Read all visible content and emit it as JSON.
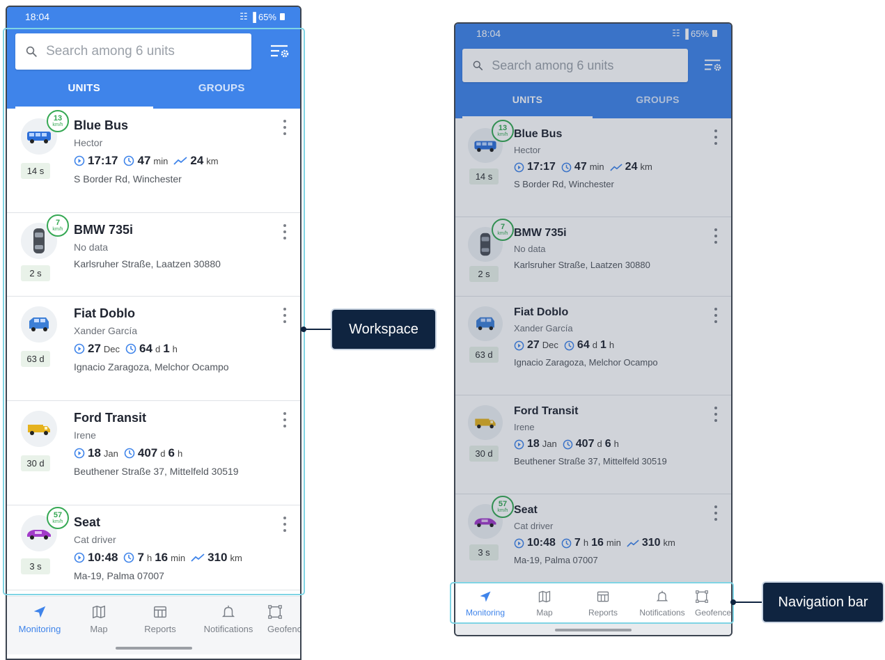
{
  "status_bar": {
    "time": "18:04",
    "battery": "65%"
  },
  "search": {
    "placeholder": "Search among 6 units"
  },
  "tabs": [
    {
      "label": "UNITS",
      "active": true
    },
    {
      "label": "GROUPS",
      "active": false
    }
  ],
  "units": [
    {
      "name": "Blue Bus",
      "driver": "Hector",
      "age": "14 s",
      "speed": "13",
      "speed_unit": "km/h",
      "time": "17:17",
      "duration_a": "47",
      "duration_a_unit": "min",
      "duration_b": "",
      "duration_b_unit": "",
      "mileage": "24",
      "mileage_unit": "km",
      "address": "S Border Rd, Winchester",
      "icon": "blue-bus-icon",
      "color": "#2d6fd8"
    },
    {
      "name": "BMW 735i",
      "driver": "No data",
      "age": "2 s",
      "speed": "7",
      "speed_unit": "km/h",
      "address": "Karlsruher Straße, Laatzen 30880",
      "icon": "black-car-icon",
      "color": "#4a4f57"
    },
    {
      "name": "Fiat Doblo",
      "driver": "Xander García",
      "age": "63 d",
      "date_day": "27",
      "date_month": "Dec",
      "duration_a": "64",
      "duration_a_unit": "d",
      "duration_b": "1",
      "duration_b_unit": "h",
      "address": "Ignacio Zaragoza, Melchor Ocampo",
      "icon": "blue-van-icon",
      "color": "#3d7fd6"
    },
    {
      "name": "Ford Transit",
      "driver": "Irene",
      "age": "30 d",
      "date_day": "18",
      "date_month": "Jan",
      "duration_a": "407",
      "duration_a_unit": "d",
      "duration_b": "6",
      "duration_b_unit": "h",
      "address": "Beuthener Straße 37, Mittelfeld 30519",
      "icon": "yellow-truck-icon",
      "color": "#e5b21f"
    },
    {
      "name": "Seat",
      "driver": "Cat driver",
      "age": "3 s",
      "speed": "57",
      "speed_unit": "km/h",
      "time": "10:48",
      "duration_a": "7",
      "duration_a_unit": "h",
      "duration_b": "16",
      "duration_b_unit": "min",
      "mileage": "310",
      "mileage_unit": "km",
      "address": "Ma-19, Palma 07007",
      "icon": "purple-car-icon",
      "color": "#a23bc9"
    }
  ],
  "navbar": [
    {
      "label": "Monitoring",
      "icon": "navigation-arrow-icon",
      "active": true
    },
    {
      "label": "Map",
      "icon": "map-icon"
    },
    {
      "label": "Reports",
      "icon": "reports-icon"
    },
    {
      "label": "Notifications",
      "icon": "bell-icon"
    },
    {
      "label": "Geofences",
      "icon": "geofence-icon"
    }
  ],
  "callouts": {
    "workspace": "Workspace",
    "navigation_bar": "Navigation bar"
  },
  "colors": {
    "accent": "#3f84ea",
    "speed_badge": "#35a853",
    "callout_bg": "#0f2440",
    "highlight": "#7fd4e4"
  }
}
